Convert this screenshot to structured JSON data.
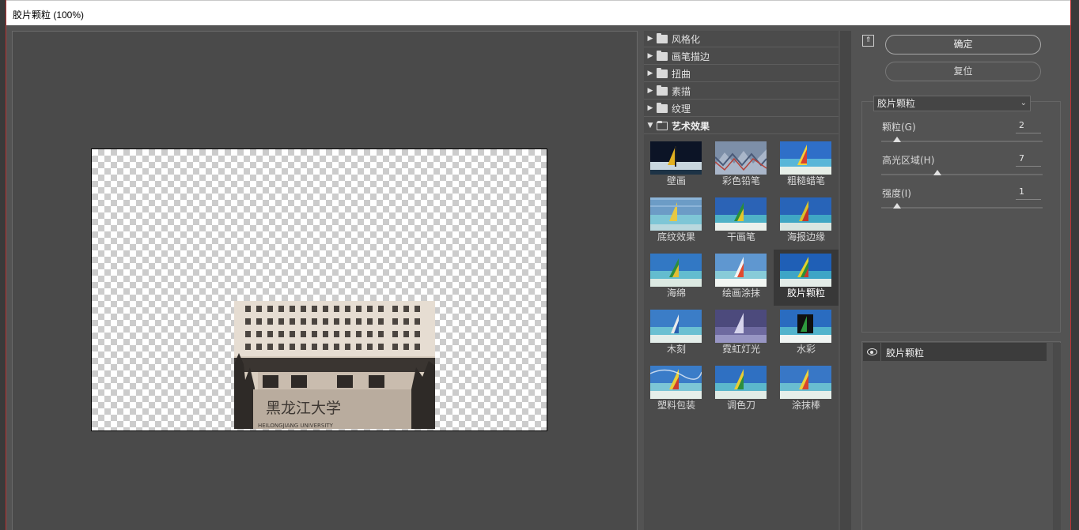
{
  "window": {
    "title": "胶片颗粒 (100%)"
  },
  "filter_categories": [
    {
      "label": "风格化",
      "expanded": false
    },
    {
      "label": "画笔描边",
      "expanded": false
    },
    {
      "label": "扭曲",
      "expanded": false
    },
    {
      "label": "素描",
      "expanded": false
    },
    {
      "label": "纹理",
      "expanded": false
    },
    {
      "label": "艺术效果",
      "expanded": true
    }
  ],
  "filters": [
    {
      "label": "壁画"
    },
    {
      "label": "彩色铅笔"
    },
    {
      "label": "粗糙蜡笔"
    },
    {
      "label": "底纹效果"
    },
    {
      "label": "干画笔"
    },
    {
      "label": "海报边缘"
    },
    {
      "label": "海绵"
    },
    {
      "label": "绘画涂抹"
    },
    {
      "label": "胶片颗粒",
      "selected": true
    },
    {
      "label": "木刻"
    },
    {
      "label": "霓虹灯光"
    },
    {
      "label": "水彩"
    },
    {
      "label": "塑料包装"
    },
    {
      "label": "调色刀"
    },
    {
      "label": "涂抹棒"
    }
  ],
  "buttons": {
    "ok": "确定",
    "reset": "复位"
  },
  "settings": {
    "selected_filter": "胶片颗粒",
    "params": [
      {
        "label": "颗粒(G)",
        "value": "2",
        "fraction": 0.1
      },
      {
        "label": "高光区域(H)",
        "value": "7",
        "fraction": 0.35
      },
      {
        "label": "强度(I)",
        "value": "1",
        "fraction": 0.1
      }
    ]
  },
  "layers": [
    {
      "name": "胶片颗粒"
    }
  ],
  "preview": {
    "photo_caption": "黑龙江大学",
    "photo_subcaption": "HEILONGJIANG UNIVERSITY"
  }
}
